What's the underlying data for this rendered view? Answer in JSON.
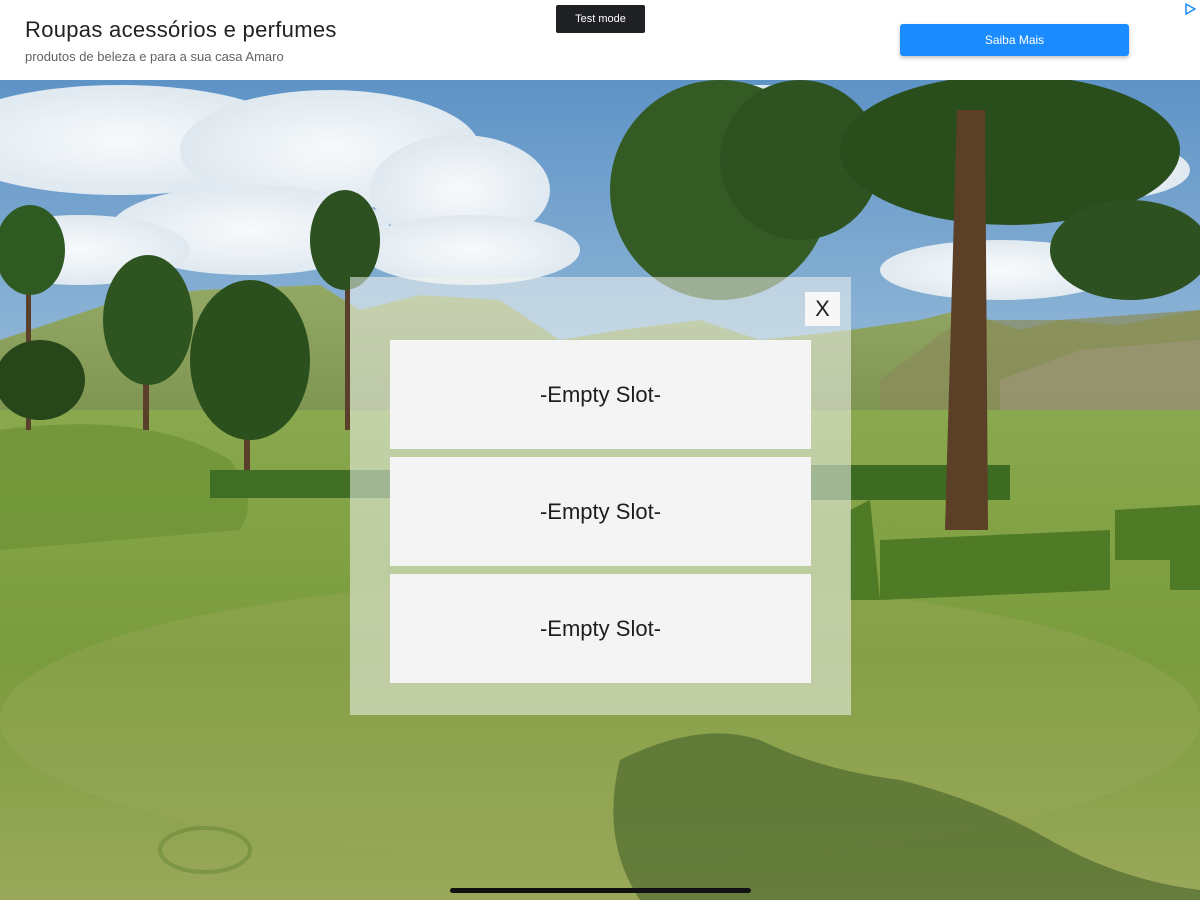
{
  "ad": {
    "title": "Roupas acessórios e perfumes",
    "subtitle": "produtos de beleza e para a sua casa Amaro",
    "test_badge": "Test mode",
    "cta_label": "Saiba Mais",
    "cta_color": "#1a8cff"
  },
  "slot_panel": {
    "close_label": "X",
    "slots": [
      {
        "label": "-Empty Slot-"
      },
      {
        "label": "-Empty Slot-"
      },
      {
        "label": "-Empty Slot-"
      }
    ]
  },
  "icons": {
    "ad_choices": "ad-choices-icon"
  }
}
